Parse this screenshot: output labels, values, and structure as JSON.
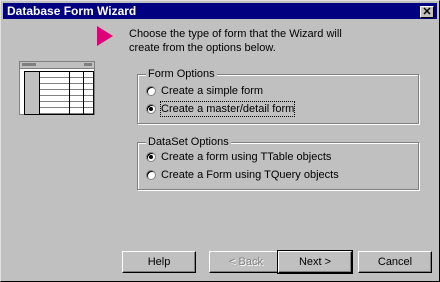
{
  "window": {
    "title": "Database Form Wizard",
    "close_glyph": "✕"
  },
  "instruction": "Choose the type of form that the Wizard will create from the options below.",
  "form_options": {
    "legend": "Form Options",
    "items": [
      {
        "label": "Create a simple form",
        "selected": false
      },
      {
        "label": "Create a master/detail form",
        "selected": true
      }
    ]
  },
  "dataset_options": {
    "legend": "DataSet Options",
    "items": [
      {
        "label": "Create a form using TTable objects",
        "selected": true
      },
      {
        "label": "Create a Form using TQuery objects",
        "selected": false
      }
    ]
  },
  "buttons": {
    "help": "Help",
    "back": "< Back",
    "next": "Next >",
    "cancel": "Cancel"
  },
  "colors": {
    "title_bar": "#000080",
    "arrow": "#e0007a",
    "face": "#c0c0c0"
  }
}
